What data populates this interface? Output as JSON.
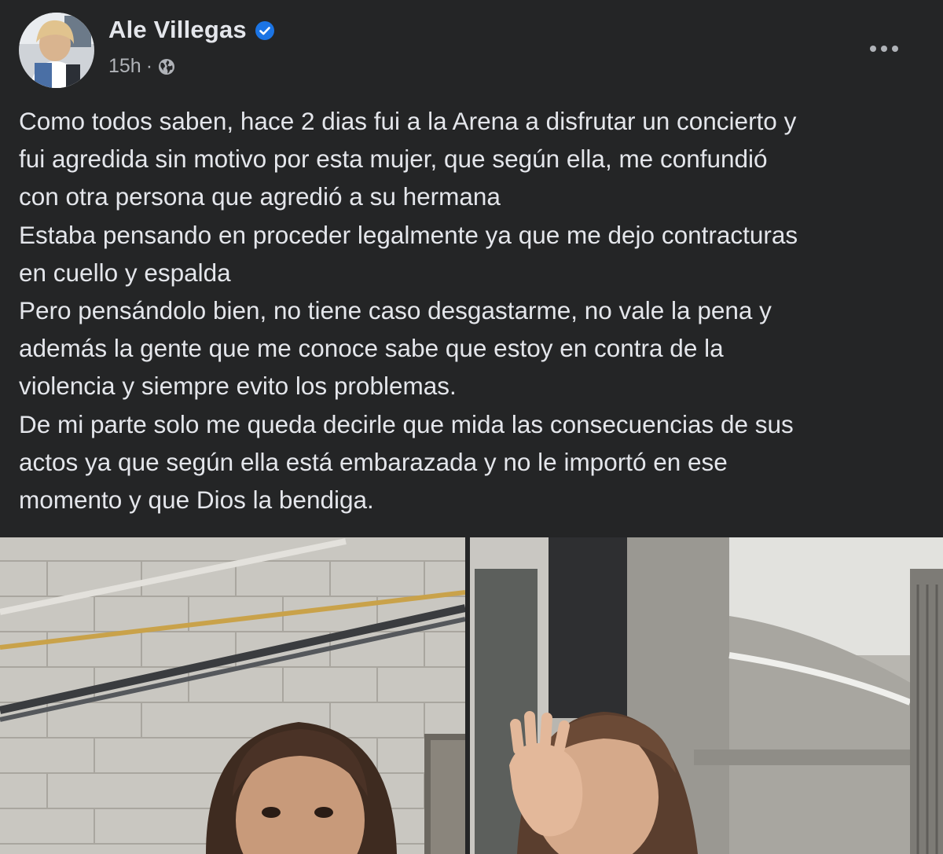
{
  "post": {
    "author": {
      "name": "Ale Villegas",
      "verified": true
    },
    "timestamp": "15h",
    "separator": "·",
    "audience_icon": "globe-icon",
    "more_icon": "more-options-icon",
    "text_lines": [
      "Como todos saben, hace 2 dias fui a la Arena a disfrutar un concierto y",
      "fui agredida sin motivo por esta mujer, que según ella, me confundió",
      "con otra persona que agredió a su hermana",
      "Estaba pensando en proceder legalmente ya que me dejo contracturas",
      "en cuello y espalda",
      "Pero pensándolo bien, no tiene caso desgastarme, no vale la pena y",
      "además la gente que me conoce sabe que estoy en contra de la",
      "violencia y siempre evito los problemas.",
      "De mi parte solo me queda decirle que mida las consecuencias de sus",
      "actos ya que según ella está embarazada y no le importó en ese",
      "momento y que Dios la bendiga."
    ],
    "media": [
      "photo-left",
      "photo-right"
    ]
  },
  "colors": {
    "background": "#242526",
    "primary_text": "#e4e6eb",
    "secondary_text": "#b0b3b8",
    "verified_badge": "#1b74e4"
  }
}
